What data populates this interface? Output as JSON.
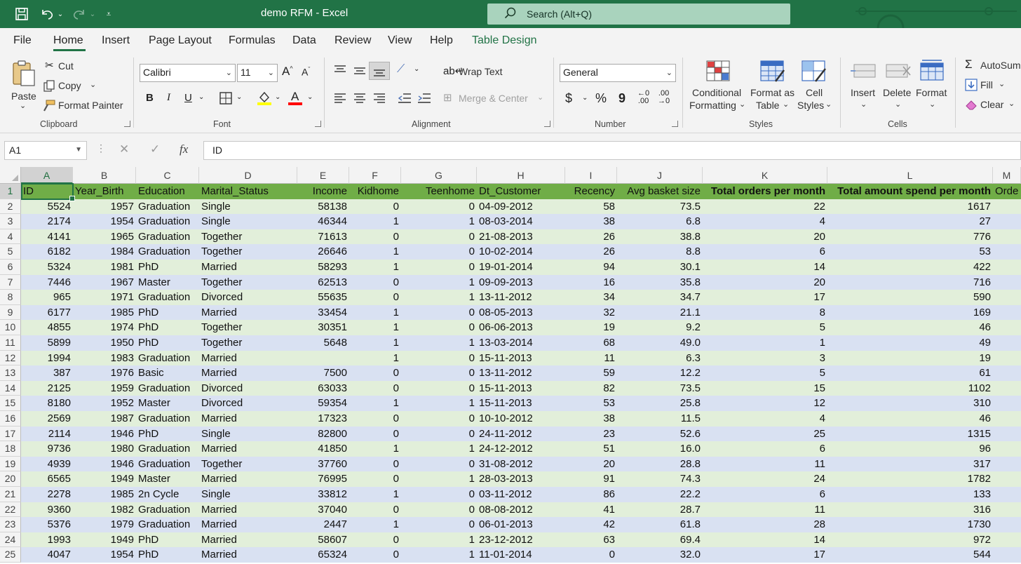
{
  "window": {
    "title": "demo RFM  -  Excel"
  },
  "search": {
    "placeholder": "Search (Alt+Q)"
  },
  "menu": {
    "tabs": [
      {
        "label": "File"
      },
      {
        "label": "Home"
      },
      {
        "label": "Insert"
      },
      {
        "label": "Page Layout"
      },
      {
        "label": "Formulas"
      },
      {
        "label": "Data"
      },
      {
        "label": "Review"
      },
      {
        "label": "View"
      },
      {
        "label": "Help"
      },
      {
        "label": "Table Design"
      }
    ]
  },
  "ribbon": {
    "clipboard": {
      "paste": "Paste",
      "cut": "Cut",
      "copy": "Copy",
      "format_painter": "Format Painter",
      "group": "Clipboard"
    },
    "font": {
      "name": "Calibri",
      "size": "11",
      "bold": "B",
      "italic": "I",
      "underline": "U",
      "font_color": "A",
      "group": "Font"
    },
    "alignment": {
      "wrap": "Wrap Text",
      "merge": "Merge & Center",
      "group": "Alignment"
    },
    "number": {
      "format": "General",
      "currency": "$",
      "percent": "%",
      "comma": "9",
      "group": "Number"
    },
    "styles": {
      "conditional1": "Conditional",
      "conditional2": "Formatting",
      "format_table1": "Format as",
      "format_table2": "Table",
      "cell_styles1": "Cell",
      "cell_styles2": "Styles",
      "group": "Styles"
    },
    "cells": {
      "insert": "Insert",
      "delete": "Delete",
      "format": "Format",
      "group": "Cells"
    },
    "editing": {
      "autosum": "AutoSum",
      "fill": "Fill",
      "clear": "Clear"
    }
  },
  "formula_bar": {
    "name_box": "A1",
    "fx": "fx",
    "value": "ID"
  },
  "colors": {
    "excel_green": "#217346",
    "table_header": "#70ad47",
    "band_green": "#e2efda",
    "band_blue": "#d9e1f2"
  },
  "sheet": {
    "columns": [
      "A",
      "B",
      "C",
      "D",
      "E",
      "F",
      "G",
      "H",
      "I",
      "J",
      "K",
      "L",
      "M"
    ],
    "header": [
      "ID",
      "Year_Birth",
      "Education",
      "Marital_Status",
      "Income",
      "Kidhome",
      "Teenhome",
      "Dt_Customer",
      "Recency",
      "Avg basket size",
      "Total orders per month",
      "Total amount spend per month",
      "Orde"
    ],
    "rows": [
      [
        "5524",
        "1957",
        "Graduation",
        "Single",
        "58138",
        "0",
        "0",
        "04-09-2012",
        "58",
        "73.5",
        "22",
        "1617"
      ],
      [
        "2174",
        "1954",
        "Graduation",
        "Single",
        "46344",
        "1",
        "1",
        "08-03-2014",
        "38",
        "6.8",
        "4",
        "27"
      ],
      [
        "4141",
        "1965",
        "Graduation",
        "Together",
        "71613",
        "0",
        "0",
        "21-08-2013",
        "26",
        "38.8",
        "20",
        "776"
      ],
      [
        "6182",
        "1984",
        "Graduation",
        "Together",
        "26646",
        "1",
        "0",
        "10-02-2014",
        "26",
        "8.8",
        "6",
        "53"
      ],
      [
        "5324",
        "1981",
        "PhD",
        "Married",
        "58293",
        "1",
        "0",
        "19-01-2014",
        "94",
        "30.1",
        "14",
        "422"
      ],
      [
        "7446",
        "1967",
        "Master",
        "Together",
        "62513",
        "0",
        "1",
        "09-09-2013",
        "16",
        "35.8",
        "20",
        "716"
      ],
      [
        "965",
        "1971",
        "Graduation",
        "Divorced",
        "55635",
        "0",
        "1",
        "13-11-2012",
        "34",
        "34.7",
        "17",
        "590"
      ],
      [
        "6177",
        "1985",
        "PhD",
        "Married",
        "33454",
        "1",
        "0",
        "08-05-2013",
        "32",
        "21.1",
        "8",
        "169"
      ],
      [
        "4855",
        "1974",
        "PhD",
        "Together",
        "30351",
        "1",
        "0",
        "06-06-2013",
        "19",
        "9.2",
        "5",
        "46"
      ],
      [
        "5899",
        "1950",
        "PhD",
        "Together",
        "5648",
        "1",
        "1",
        "13-03-2014",
        "68",
        "49.0",
        "1",
        "49"
      ],
      [
        "1994",
        "1983",
        "Graduation",
        "Married",
        "",
        "1",
        "0",
        "15-11-2013",
        "11",
        "6.3",
        "3",
        "19"
      ],
      [
        "387",
        "1976",
        "Basic",
        "Married",
        "7500",
        "0",
        "0",
        "13-11-2012",
        "59",
        "12.2",
        "5",
        "61"
      ],
      [
        "2125",
        "1959",
        "Graduation",
        "Divorced",
        "63033",
        "0",
        "0",
        "15-11-2013",
        "82",
        "73.5",
        "15",
        "1102"
      ],
      [
        "8180",
        "1952",
        "Master",
        "Divorced",
        "59354",
        "1",
        "1",
        "15-11-2013",
        "53",
        "25.8",
        "12",
        "310"
      ],
      [
        "2569",
        "1987",
        "Graduation",
        "Married",
        "17323",
        "0",
        "0",
        "10-10-2012",
        "38",
        "11.5",
        "4",
        "46"
      ],
      [
        "2114",
        "1946",
        "PhD",
        "Single",
        "82800",
        "0",
        "0",
        "24-11-2012",
        "23",
        "52.6",
        "25",
        "1315"
      ],
      [
        "9736",
        "1980",
        "Graduation",
        "Married",
        "41850",
        "1",
        "1",
        "24-12-2012",
        "51",
        "16.0",
        "6",
        "96"
      ],
      [
        "4939",
        "1946",
        "Graduation",
        "Together",
        "37760",
        "0",
        "0",
        "31-08-2012",
        "20",
        "28.8",
        "11",
        "317"
      ],
      [
        "6565",
        "1949",
        "Master",
        "Married",
        "76995",
        "0",
        "1",
        "28-03-2013",
        "91",
        "74.3",
        "24",
        "1782"
      ],
      [
        "2278",
        "1985",
        "2n Cycle",
        "Single",
        "33812",
        "1",
        "0",
        "03-11-2012",
        "86",
        "22.2",
        "6",
        "133"
      ],
      [
        "9360",
        "1982",
        "Graduation",
        "Married",
        "37040",
        "0",
        "0",
        "08-08-2012",
        "41",
        "28.7",
        "11",
        "316"
      ],
      [
        "5376",
        "1979",
        "Graduation",
        "Married",
        "2447",
        "1",
        "0",
        "06-01-2013",
        "42",
        "61.8",
        "28",
        "1730"
      ],
      [
        "1993",
        "1949",
        "PhD",
        "Married",
        "58607",
        "0",
        "1",
        "23-12-2012",
        "63",
        "69.4",
        "14",
        "972"
      ],
      [
        "4047",
        "1954",
        "PhD",
        "Married",
        "65324",
        "0",
        "1",
        "11-01-2014",
        "0",
        "32.0",
        "17",
        "544"
      ]
    ]
  }
}
